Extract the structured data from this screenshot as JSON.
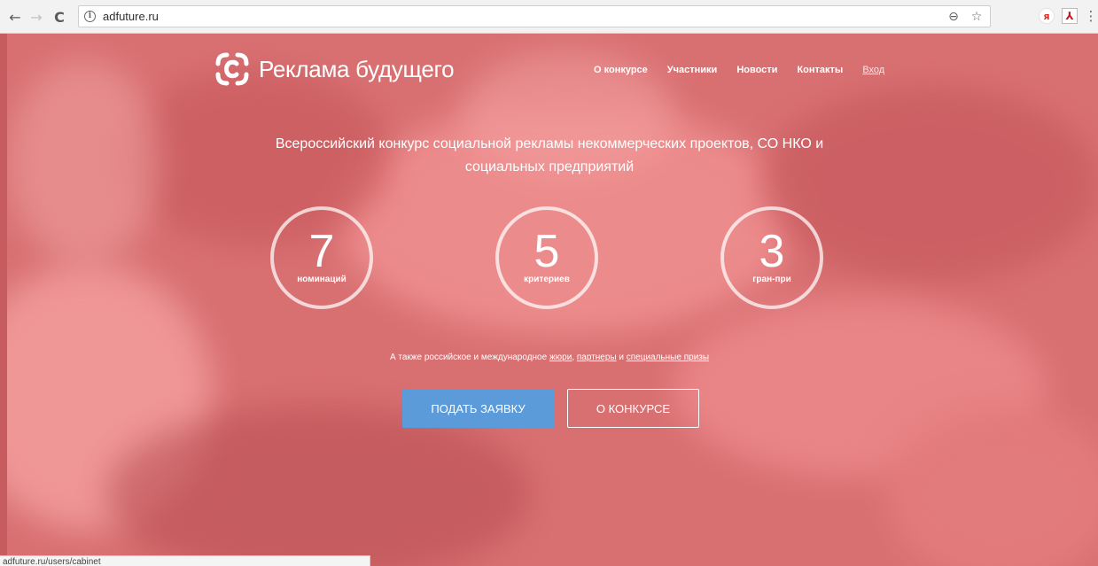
{
  "browser": {
    "url": "adfuture.ru",
    "back_icon": "←",
    "forward_icon": "→",
    "reload_icon": "C",
    "info_icon": "i",
    "zoom_icon": "⊖",
    "star_icon": "☆",
    "yandex_icon": "я",
    "pdf_icon": "⅄",
    "menu_icon": "⋮"
  },
  "site": {
    "logo_text": "Реклама будущего",
    "nav": [
      "О конкурсе",
      "Участники",
      "Новости",
      "Контакты",
      "Вход"
    ],
    "tagline_line1": "Всероссийский конкурс социальной рекламы некоммерческих проектов, СО НКО и",
    "tagline_line2": "социальных предприятий",
    "stats": [
      {
        "number": "7",
        "label": "номинаций"
      },
      {
        "number": "5",
        "label": "критериев"
      },
      {
        "number": "3",
        "label": "гран-при"
      }
    ],
    "also": {
      "prefix": "А также российское и международное",
      "jury": "жюри",
      "comma": ",",
      "partners": "партнеры",
      "and": "и",
      "prizes": "специальные призы"
    },
    "buttons": {
      "apply": "ПОДАТЬ ЗАЯВКУ",
      "about": "О КОНКУРСЕ"
    },
    "status_url": "adfuture.ru/users/cabinet"
  },
  "colors": {
    "hero_overlay": "#d87072",
    "apply_button": "#5b9bd9"
  }
}
